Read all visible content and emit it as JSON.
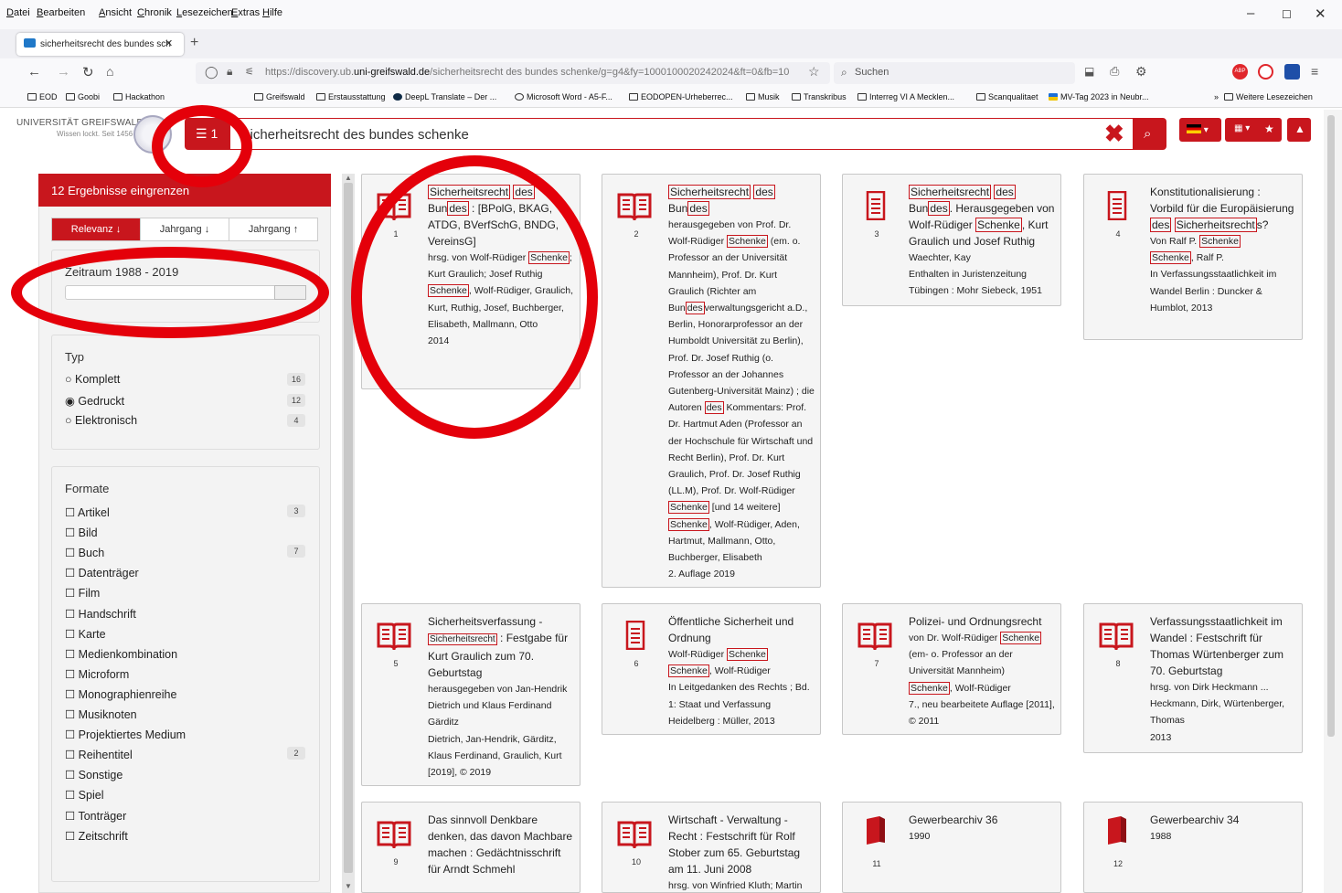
{
  "browser": {
    "menu": [
      "Datei",
      "Bearbeiten",
      "Ansicht",
      "Chronik",
      "Lesezeichen",
      "Extras",
      "Hilfe"
    ],
    "tab_title": "sicherheitsrecht des bundes sch",
    "url_prefix": "https://discovery.ub.",
    "url_domain": "uni-greifswald.de",
    "url_rest": "/sicherheitsrecht des bundes schenke/g=g4&fy=1000100020242024&ft=0&fb=10",
    "search_placeholder": "Suchen",
    "bookmarks": [
      "EOD",
      "Goobi",
      "Hackathon",
      "Greifswald",
      "Erstausstattung",
      "DeepL Translate – Der ...",
      "Microsoft Word - A5-F...",
      "EODOPEN-Urheberrec...",
      "Musik",
      "Transkribus",
      "Interreg VI A Mecklen...",
      "Scanqualitaet",
      "MV-Tag 2023 in Neubr...",
      "Weitere Lesezeichen"
    ],
    "colors": {
      "accent": "#c8161d",
      "chrome": "#f9f9fb"
    }
  },
  "header": {
    "logo_title": "UNIVERSITÄT GREIFSWALD",
    "logo_sub": "Wissen lockt. Seit 1456",
    "filter_count": "1",
    "query": "sicherheitsrecht des bundes schenke"
  },
  "sidebar": {
    "title": "12 Ergebnisse eingrenzen",
    "sort": [
      "Relevanz ↓",
      "Jahrgang ↓",
      "Jahrgang ↑"
    ],
    "range_label": "Zeitraum 1988 - 2019",
    "typ_heading": "Typ",
    "typ": [
      {
        "label": "Komplett",
        "count": "16",
        "selected": false
      },
      {
        "label": "Gedruckt",
        "count": "12",
        "selected": true
      },
      {
        "label": "Elektronisch",
        "count": "4",
        "selected": false
      }
    ],
    "formate_heading": "Formate",
    "formate": [
      {
        "label": "Artikel",
        "count": "3"
      },
      {
        "label": "Bild",
        "count": ""
      },
      {
        "label": "Buch",
        "count": "7"
      },
      {
        "label": "Datenträger",
        "count": ""
      },
      {
        "label": "Film",
        "count": ""
      },
      {
        "label": "Handschrift",
        "count": ""
      },
      {
        "label": "Karte",
        "count": ""
      },
      {
        "label": "Medienkombination",
        "count": ""
      },
      {
        "label": "Microform",
        "count": ""
      },
      {
        "label": "Monographienreihe",
        "count": ""
      },
      {
        "label": "Musiknoten",
        "count": ""
      },
      {
        "label": "Projektiertes Medium",
        "count": ""
      },
      {
        "label": "Reihentitel",
        "count": "2"
      },
      {
        "label": "Sonstige",
        "count": ""
      },
      {
        "label": "Spiel",
        "count": ""
      },
      {
        "label": "Tonträger",
        "count": ""
      },
      {
        "label": "Zeitschrift",
        "count": ""
      }
    ]
  },
  "results": [
    {
      "num": "1",
      "icon": "book-icon",
      "title_html": "<span class='hl'>Sicherheitsrecht</span> <span class='hl'>des</span> Bun<span class='hl'>des</span> : [BPolG, BKAG, ATDG, BVerfSchG, BNDG, VereinsG]",
      "lines": [
        "hrsg. von Wolf-Rüdiger <span class='hl'>Schenke</span>; Kurt Graulich; Josef Ruthig",
        "<span class='hl'>Schenke</span>, Wolf-Rüdiger, Graulich, Kurt, Ruthig, Josef, Buchberger, Elisabeth, Mallmann, Otto",
        "2014"
      ]
    },
    {
      "num": "2",
      "icon": "book-icon",
      "title_html": "<span class='hl'>Sicherheitsrecht</span> <span class='hl'>des</span> Bun<span class='hl'>des</span>",
      "lines": [
        "herausgegeben von Prof. Dr. Wolf-Rüdiger <span class='hl'>Schenke</span> (em. o. Professor an der Universität Mannheim), Prof. Dr. Kurt Graulich (Richter am Bun<span class='hl'>des</span>verwaltungsgericht a.D., Berlin, Honorarprofessor an der Humboldt Universität zu Berlin), Prof. Dr. Josef Ruthig (o. Professor an der Johannes Gutenberg-Universität Mainz) ; die Autoren <span class='hl'>des</span> Kommentars: Prof. Dr. Hartmut Aden (Professor an der Hochschule für Wirtschaft und Recht Berlin), Prof. Dr. Kurt Graulich, Prof. Dr. Josef Ruthig (LL.M), Prof. Dr. Wolf-Rüdiger <span class='hl'>Schenke</span> [und 14 weitere]",
        "<span class='hl'>Schenke</span>, Wolf-Rüdiger, Aden, Hartmut, Mallmann, Otto, Buchberger, Elisabeth",
        "2. Auflage 2019"
      ]
    },
    {
      "num": "3",
      "icon": "article-icon",
      "title_html": "<span class='hl'>Sicherheitsrecht</span> <span class='hl'>des</span> Bun<span class='hl'>des</span>. Herausgegeben von Wolf-Rüdiger <span class='hl'>Schenke</span>, Kurt Graulich und Josef Ruthig",
      "lines": [
        "Waechter, Kay",
        "Enthalten in Juristenzeitung",
        "Tübingen : Mohr Siebeck, 1951"
      ]
    },
    {
      "num": "4",
      "icon": "article-icon",
      "title_html": "Konstitutionalisierung : Vorbild für die Europäisierung <span class='hl'>des</span> <span class='hl'>Sicherheitsrecht</span>s?",
      "lines": [
        "Von Ralf P. <span class='hl'>Schenke</span>",
        "<span class='hl'>Schenke</span>, Ralf P.",
        "In Verfassungsstaatlichkeit im Wandel Berlin : Duncker & Humblot, 2013"
      ]
    },
    {
      "num": "5",
      "icon": "book-icon",
      "title_html": "Sicherheitsverfassung - <span class='hl' style='font-size:10px'>Sicherheitsrecht</span> : Festgabe für Kurt Graulich zum 70. Geburtstag",
      "lines": [
        "herausgegeben von Jan-Hendrik Dietrich und Klaus Ferdinand Gärditz",
        "Dietrich, Jan-Hendrik, Gärditz, Klaus Ferdinand, Graulich, Kurt",
        "[2019], © 2019"
      ]
    },
    {
      "num": "6",
      "icon": "article-icon",
      "title_html": "Öffentliche Sicherheit und Ordnung",
      "lines": [
        "Wolf-Rüdiger <span class='hl'>Schenke</span>",
        "<span class='hl'>Schenke</span>, Wolf-Rüdiger",
        "In Leitgedanken des Rechts ; Bd. 1: Staat und Verfassung",
        "Heidelberg : Müller, 2013"
      ]
    },
    {
      "num": "7",
      "icon": "book-icon",
      "title_html": "Polizei- und Ordnungsrecht",
      "lines": [
        "von Dr. Wolf-Rüdiger <span class='hl'>Schenke</span> (em- o. Professor an der Universität Mannheim)",
        "<span class='hl'>Schenke</span>, Wolf-Rüdiger",
        "7., neu bearbeitete Auflage [2011], © 2011"
      ]
    },
    {
      "num": "8",
      "icon": "book-icon",
      "title_html": "Verfassungsstaatlichkeit im Wandel : Festschrift für Thomas Würtenberger zum 70. Geburtstag",
      "lines": [
        "hrsg. von Dirk Heckmann ...",
        "Heckmann, Dirk, Würtenberger, Thomas",
        "2013"
      ]
    },
    {
      "num": "9",
      "icon": "book-icon",
      "title_html": "Das sinnvoll Denkbare denken, das davon Machbare machen : Gedächtnisschrift für Arndt Schmehl",
      "lines": []
    },
    {
      "num": "10",
      "icon": "book-icon",
      "title_html": "Wirtschaft - Verwaltung - Recht : Festschrift für Rolf Stober zum 65. Geburtstag am 11. Juni 2008",
      "lines": [
        "hrsg. von Winfried Kluth; Martin"
      ]
    },
    {
      "num": "11",
      "icon": "journal-icon",
      "title_html": "Gewerbearchiv 36",
      "lines": [
        "1990"
      ]
    },
    {
      "num": "12",
      "icon": "journal-icon",
      "title_html": "Gewerbearchiv 34",
      "lines": [
        "1988"
      ]
    }
  ]
}
